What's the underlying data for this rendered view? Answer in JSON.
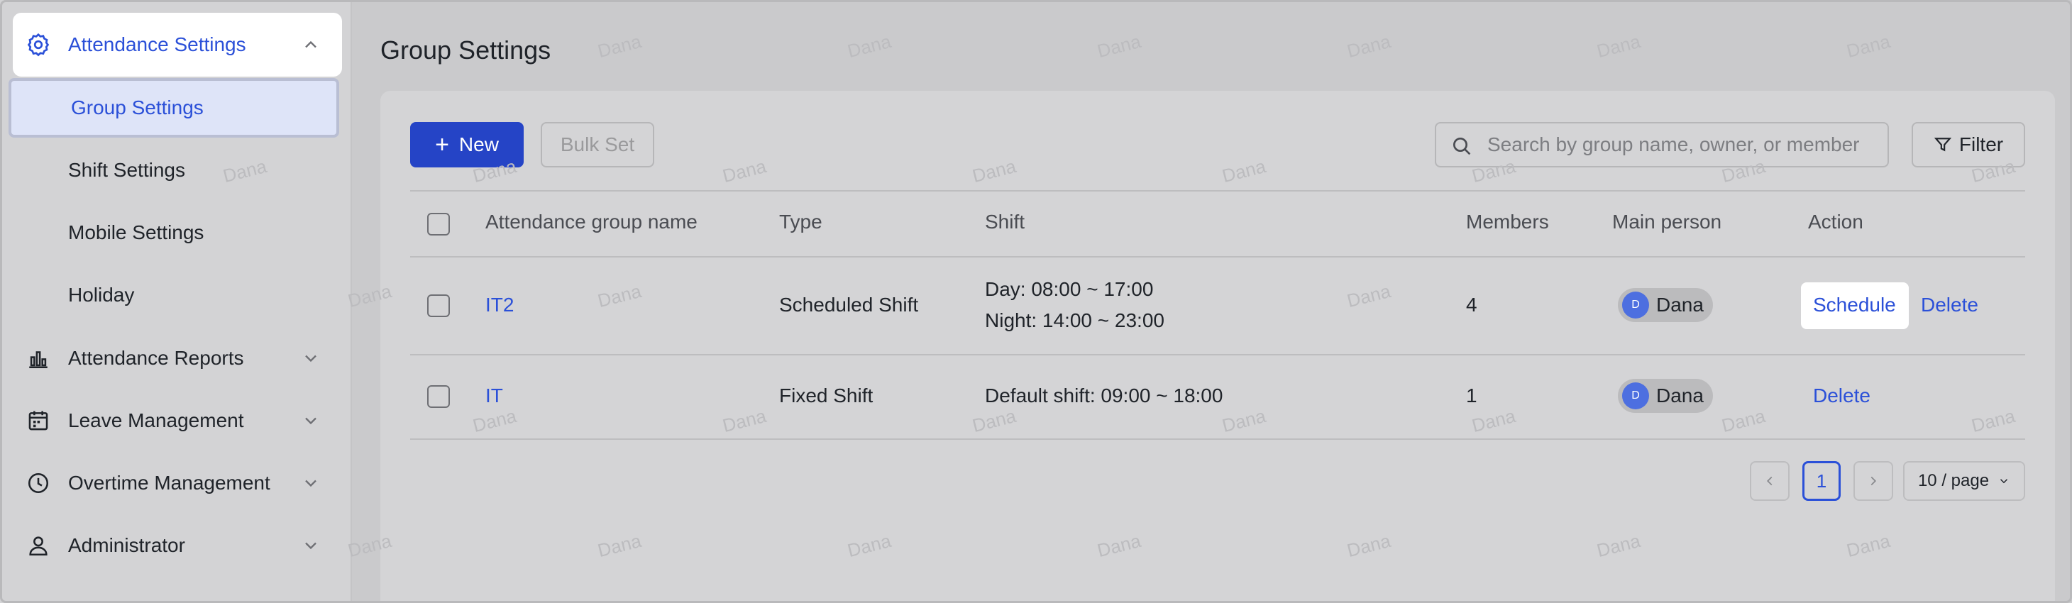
{
  "sidebar": {
    "attendance_settings": "Attendance Settings",
    "group_settings": "Group Settings",
    "shift_settings": "Shift Settings",
    "mobile_settings": "Mobile Settings",
    "holiday": "Holiday",
    "attendance_reports": "Attendance Reports",
    "leave_management": "Leave Management",
    "overtime_management": "Overtime Management",
    "administrator": "Administrator"
  },
  "page": {
    "title": "Group Settings"
  },
  "toolbar": {
    "new_label": "New",
    "bulk_set_label": "Bulk Set",
    "search_placeholder": "Search by group name, owner, or member",
    "filter_label": "Filter"
  },
  "table": {
    "headers": {
      "name": "Attendance group name",
      "type": "Type",
      "shift": "Shift",
      "members": "Members",
      "main_person": "Main person",
      "action": "Action"
    },
    "rows": [
      {
        "name": "IT2",
        "type": "Scheduled Shift",
        "shift_line1": "Day: 08:00 ~ 17:00",
        "shift_line2": "Night: 14:00 ~ 23:00",
        "members": "4",
        "person_initial": "D",
        "person_name": "Dana",
        "action_schedule": "Schedule",
        "action_delete": "Delete"
      },
      {
        "name": "IT",
        "type": "Fixed Shift",
        "shift_line1": "Default shift: 09:00 ~ 18:00",
        "members": "1",
        "person_initial": "D",
        "person_name": "Dana",
        "action_delete": "Delete"
      }
    ]
  },
  "pagination": {
    "current_page": "1",
    "page_size": "10 / page"
  },
  "watermark": "Dana",
  "colors": {
    "accent": "#2b50d8",
    "primary_button": "#2544c6"
  }
}
